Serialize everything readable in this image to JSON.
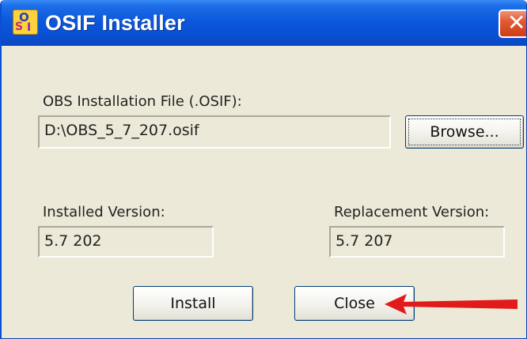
{
  "window": {
    "title": "OSIF Installer",
    "icon": "osif-app-icon",
    "icon_glyphs": [
      "O",
      "S",
      "I"
    ],
    "close_glyph": "✕"
  },
  "file_section": {
    "label": "OBS Installation File (.OSIF):",
    "value": "D:\\OBS_5_7_207.osif",
    "browse_label": "Browse..."
  },
  "installed": {
    "label": "Installed Version:",
    "value": "5.7 202"
  },
  "replacement": {
    "label": "Replacement Version:",
    "value": "5.7 207"
  },
  "actions": {
    "install_label": "Install",
    "close_label": "Close"
  },
  "colors": {
    "titlebar": "#0a50d2",
    "dialog_bg": "#ece9d8",
    "annotation_arrow": "#e11a1a"
  }
}
